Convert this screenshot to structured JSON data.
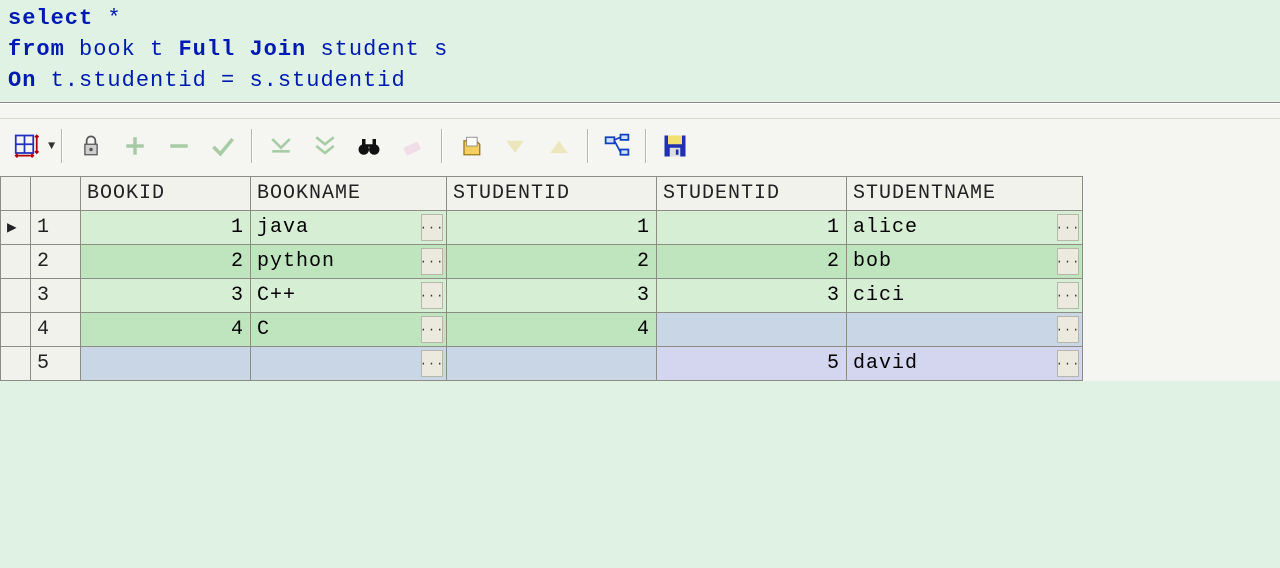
{
  "sql": {
    "kw_select": "select",
    "star": " *",
    "kw_from": "from",
    "t1": " book t ",
    "kw_fulljoin": "Full Join",
    "t2": " student s",
    "kw_on": "On",
    "cond": " t.studentid = s.studentid"
  },
  "columns": [
    "BOOKID",
    "BOOKNAME",
    "STUDENTID",
    "STUDENTID",
    "STUDENTNAME"
  ],
  "chart_data": {
    "type": "table",
    "columns": [
      "BOOKID",
      "BOOKNAME",
      "STUDENTID",
      "STUDENTID",
      "STUDENTNAME"
    ],
    "rows": [
      {
        "BOOKID": 1,
        "BOOKNAME": "java",
        "STUDENTID_1": 1,
        "STUDENTID_2": 1,
        "STUDENTNAME": "alice"
      },
      {
        "BOOKID": 2,
        "BOOKNAME": "python",
        "STUDENTID_1": 2,
        "STUDENTID_2": 2,
        "STUDENTNAME": "bob"
      },
      {
        "BOOKID": 3,
        "BOOKNAME": "C++",
        "STUDENTID_1": 3,
        "STUDENTID_2": 3,
        "STUDENTNAME": "cici"
      },
      {
        "BOOKID": 4,
        "BOOKNAME": "C",
        "STUDENTID_1": 4,
        "STUDENTID_2": null,
        "STUDENTNAME": null
      },
      {
        "BOOKID": null,
        "BOOKNAME": null,
        "STUDENTID_1": null,
        "STUDENTID_2": 5,
        "STUDENTNAME": "david"
      }
    ]
  },
  "rows": [
    {
      "n": "1",
      "marker": "▶",
      "bookid": "1",
      "bookname": "java",
      "sid1": "1",
      "sid2": "1",
      "sname": "alice",
      "alt": "alt0"
    },
    {
      "n": "2",
      "marker": "",
      "bookid": "2",
      "bookname": "python",
      "sid1": "2",
      "sid2": "2",
      "sname": "bob",
      "alt": "alt1"
    },
    {
      "n": "3",
      "marker": "",
      "bookid": "3",
      "bookname": "C++",
      "sid1": "3",
      "sid2": "3",
      "sname": "cici",
      "alt": "alt0"
    },
    {
      "n": "4",
      "marker": "",
      "bookid": "4",
      "bookname": "C",
      "sid1": "4",
      "sid2": "",
      "sname": "",
      "alt": "alt1",
      "nullcols": [
        "sid2",
        "sname"
      ]
    },
    {
      "n": "5",
      "marker": "",
      "bookid": "",
      "bookname": "",
      "sid1": "",
      "sid2": "5",
      "sname": "david",
      "alt": "null-row",
      "nullcols": [
        "bookid",
        "bookname",
        "sid1"
      ]
    }
  ],
  "ellipsis": "···"
}
